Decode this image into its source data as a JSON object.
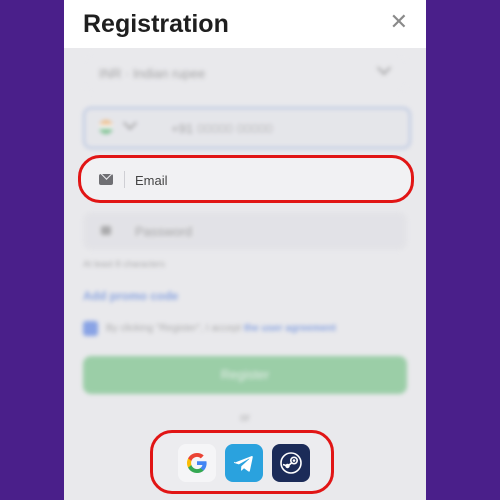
{
  "modal": {
    "title": "Registration",
    "close_glyph": "✕"
  },
  "form": {
    "currency": "INR · Indian rupee",
    "phone_code": "+91",
    "phone_placeholder": "00000 00000",
    "email_placeholder": "Email",
    "password_placeholder": "Password",
    "password_hint": "At least 8 characters",
    "promo_link": "Add promo code",
    "agreement_text": "By clicking \"Register\", I accept",
    "agreement_link": "the user agreement",
    "register_label": "Register",
    "or_label": "or"
  },
  "social": [
    {
      "name": "google",
      "icon": "google-icon"
    },
    {
      "name": "telegram",
      "icon": "telegram-icon",
      "color": "#2aa2de"
    },
    {
      "name": "steam",
      "icon": "steam-icon",
      "color": "#1b2b58"
    }
  ],
  "colors": {
    "background": "#4a1f8a",
    "highlight": "#e11515",
    "accent": "#3c6bd6",
    "register": "#5cb870"
  }
}
